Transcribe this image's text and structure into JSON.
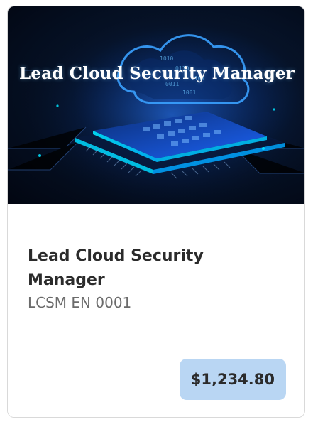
{
  "card": {
    "image_caption": "Lead Cloud Security Manager",
    "title": "Lead Cloud Security Manager",
    "code": "LCSM EN 0001",
    "price": "$1,234.80"
  },
  "colors": {
    "price_badge": "#b9d6f3",
    "title_text": "#2b2b2b",
    "code_text": "#6b6b6b"
  }
}
